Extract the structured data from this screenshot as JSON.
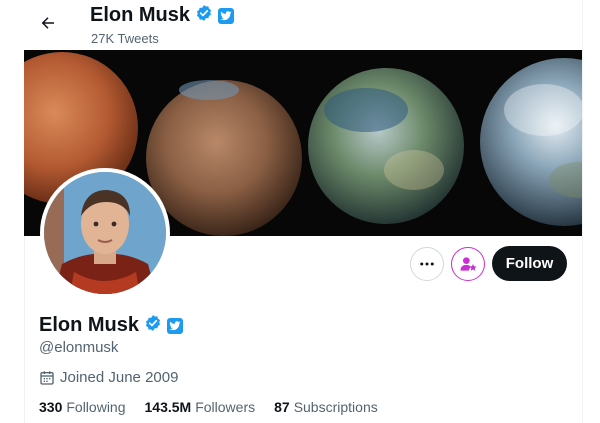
{
  "header": {
    "name": "Elon Musk",
    "tweets": "27K Tweets"
  },
  "profile": {
    "name": "Elon Musk",
    "handle": "@elonmusk",
    "joined": "Joined June 2009"
  },
  "actions": {
    "follow_label": "Follow"
  },
  "stats": [
    {
      "value": "330",
      "label": "Following"
    },
    {
      "value": "143.5M",
      "label": "Followers"
    },
    {
      "value": "87",
      "label": "Subscriptions"
    }
  ],
  "colors": {
    "verified_blue": "#1d9bf0",
    "subscribe_accent": "#c92fd2",
    "text_primary": "#0f1419",
    "text_secondary": "#536471",
    "follow_bg": "#0f1419"
  },
  "icons": [
    "back-arrow-icon",
    "verified-badge-icon",
    "twitter-logo-icon",
    "more-icon",
    "subscribe-star-icon",
    "calendar-icon"
  ]
}
